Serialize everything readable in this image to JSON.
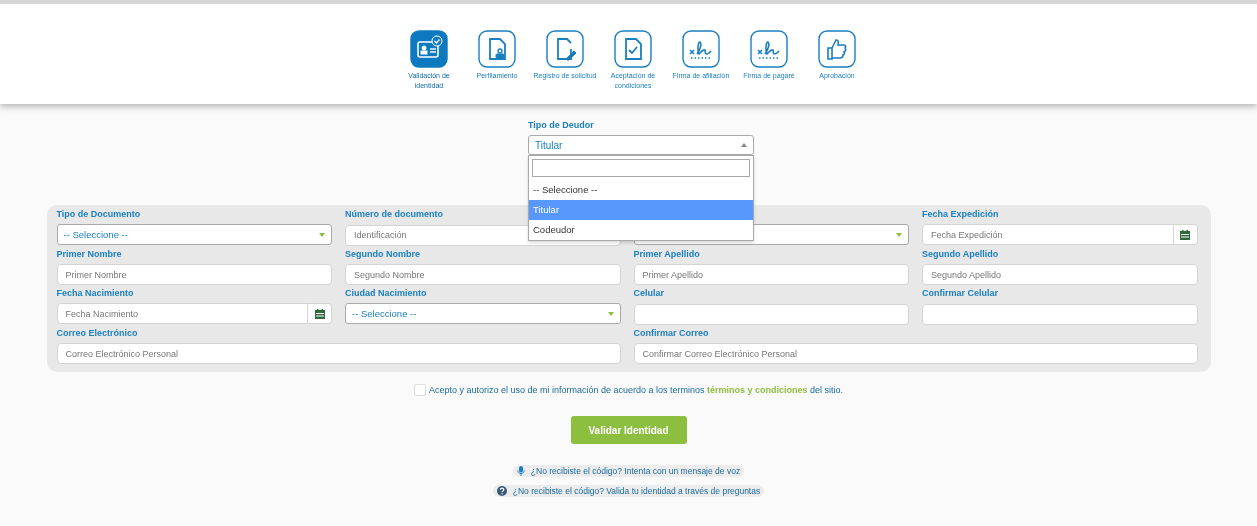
{
  "steps": [
    {
      "label": "Validación de identidad",
      "kind": "identity",
      "selected": true
    },
    {
      "label": "Perfilamiento",
      "kind": "profile",
      "selected": false
    },
    {
      "label": "Registro de solicitud",
      "kind": "request",
      "selected": false
    },
    {
      "label": "Aceptación de condiciones",
      "kind": "acceptance",
      "selected": false
    },
    {
      "label": "Firma de afiliación",
      "kind": "signature",
      "selected": false
    },
    {
      "label": "Firma de pagaré",
      "kind": "signature",
      "selected": false
    },
    {
      "label": "Aprobación",
      "kind": "approval",
      "selected": false
    }
  ],
  "debtor_type": {
    "label": "Tipo de Deudor",
    "value": "Titular",
    "expanded": true,
    "options": [
      {
        "label": "-- Seleccione --",
        "selected": false
      },
      {
        "label": "Titular",
        "selected": true
      },
      {
        "label": "Codeudor",
        "selected": false
      }
    ]
  },
  "form": {
    "fields": [
      {
        "label": "Tipo de Documento",
        "kind": "select",
        "value": "-- Seleccione --",
        "wide": false
      },
      {
        "label": "Número de documento",
        "kind": "text",
        "placeholder": "Identificación",
        "wide": false
      },
      {
        "kind": "select",
        "wide": false
      },
      {
        "label": "Fecha Expedición",
        "kind": "date",
        "placeholder": "Fecha Expedición",
        "wide": false
      },
      {
        "label": "Primer Nombre",
        "kind": "text",
        "placeholder": "Primer Nombre",
        "wide": false
      },
      {
        "label": "Segundo Nombre",
        "kind": "text",
        "placeholder": "Segundo Nombre",
        "wide": false
      },
      {
        "label": "Primer Apellido",
        "kind": "text",
        "placeholder": "Primer Apellido",
        "wide": false
      },
      {
        "label": "Segundo Apellido",
        "kind": "text",
        "placeholder": "Segundo Apellido",
        "wide": false
      },
      {
        "label": "Fecha Nacimiento",
        "kind": "date",
        "placeholder": "Fecha Nacimiento",
        "wide": false
      },
      {
        "label": "Ciudad Nacimiento",
        "kind": "select",
        "value": "-- Seleccione --",
        "wide": false
      },
      {
        "label": "Celular",
        "kind": "text",
        "wide": false
      },
      {
        "label": "Confirmar Celular",
        "kind": "text",
        "wide": false
      },
      {
        "label": "Correo Electrónico",
        "kind": "text",
        "placeholder": "Correo Electrónico Personal",
        "wide": true
      },
      {
        "label": "Confirmar Correo",
        "kind": "text",
        "placeholder": "Confirmar Correo Electrónico Personal",
        "wide": true
      }
    ]
  },
  "consent": {
    "checked": false,
    "text_before": "Acepto y autorizo el uso de mi información de acuerdo a los terminos",
    "link": "términos y condiciones",
    "text_after": "del sitio."
  },
  "submit_button": "Validar Identidad",
  "help_links": [
    {
      "kind": "microphone",
      "text": "¿No recibiste el código? Intenta con un mensaje de voz"
    },
    {
      "kind": "question",
      "text": "¿No recibiste el código? Valida tu identidad a través de preguntas"
    }
  ]
}
